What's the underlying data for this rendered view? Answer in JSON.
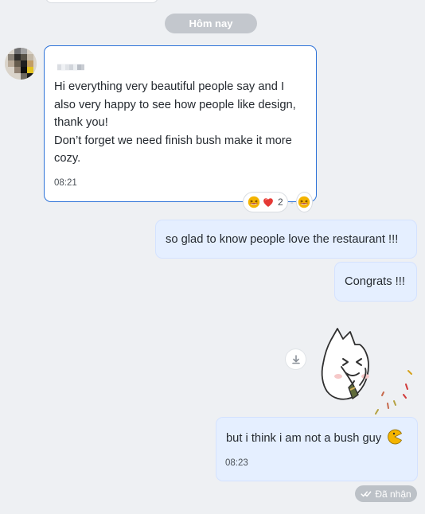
{
  "chat": {
    "date_separator": "Hôm nay",
    "incoming": {
      "text": "Hi everything very beautiful people say and I also very happy to see how people like design, thank you!\nDon’t forget we need finish bush make it more cozy.",
      "time": "08:21",
      "reactions": {
        "group": [
          "laughing-emoji",
          "heart-emoji"
        ],
        "count": "2",
        "single": "laughing-emoji"
      }
    },
    "outgoing": [
      {
        "text": "so glad to know people love the restaurant !!!"
      },
      {
        "text": "Congrats !!!"
      },
      {
        "text": "but i think i am not a bush guy",
        "time": "08:23",
        "icon": "pacman-emoji"
      }
    ],
    "status": "Đã nhận"
  },
  "colors": {
    "background": "#eef0f3",
    "incoming_border": "#2e73d8",
    "outgoing_bubble": "#e5efff",
    "status_pill": "#bcc1c7"
  }
}
